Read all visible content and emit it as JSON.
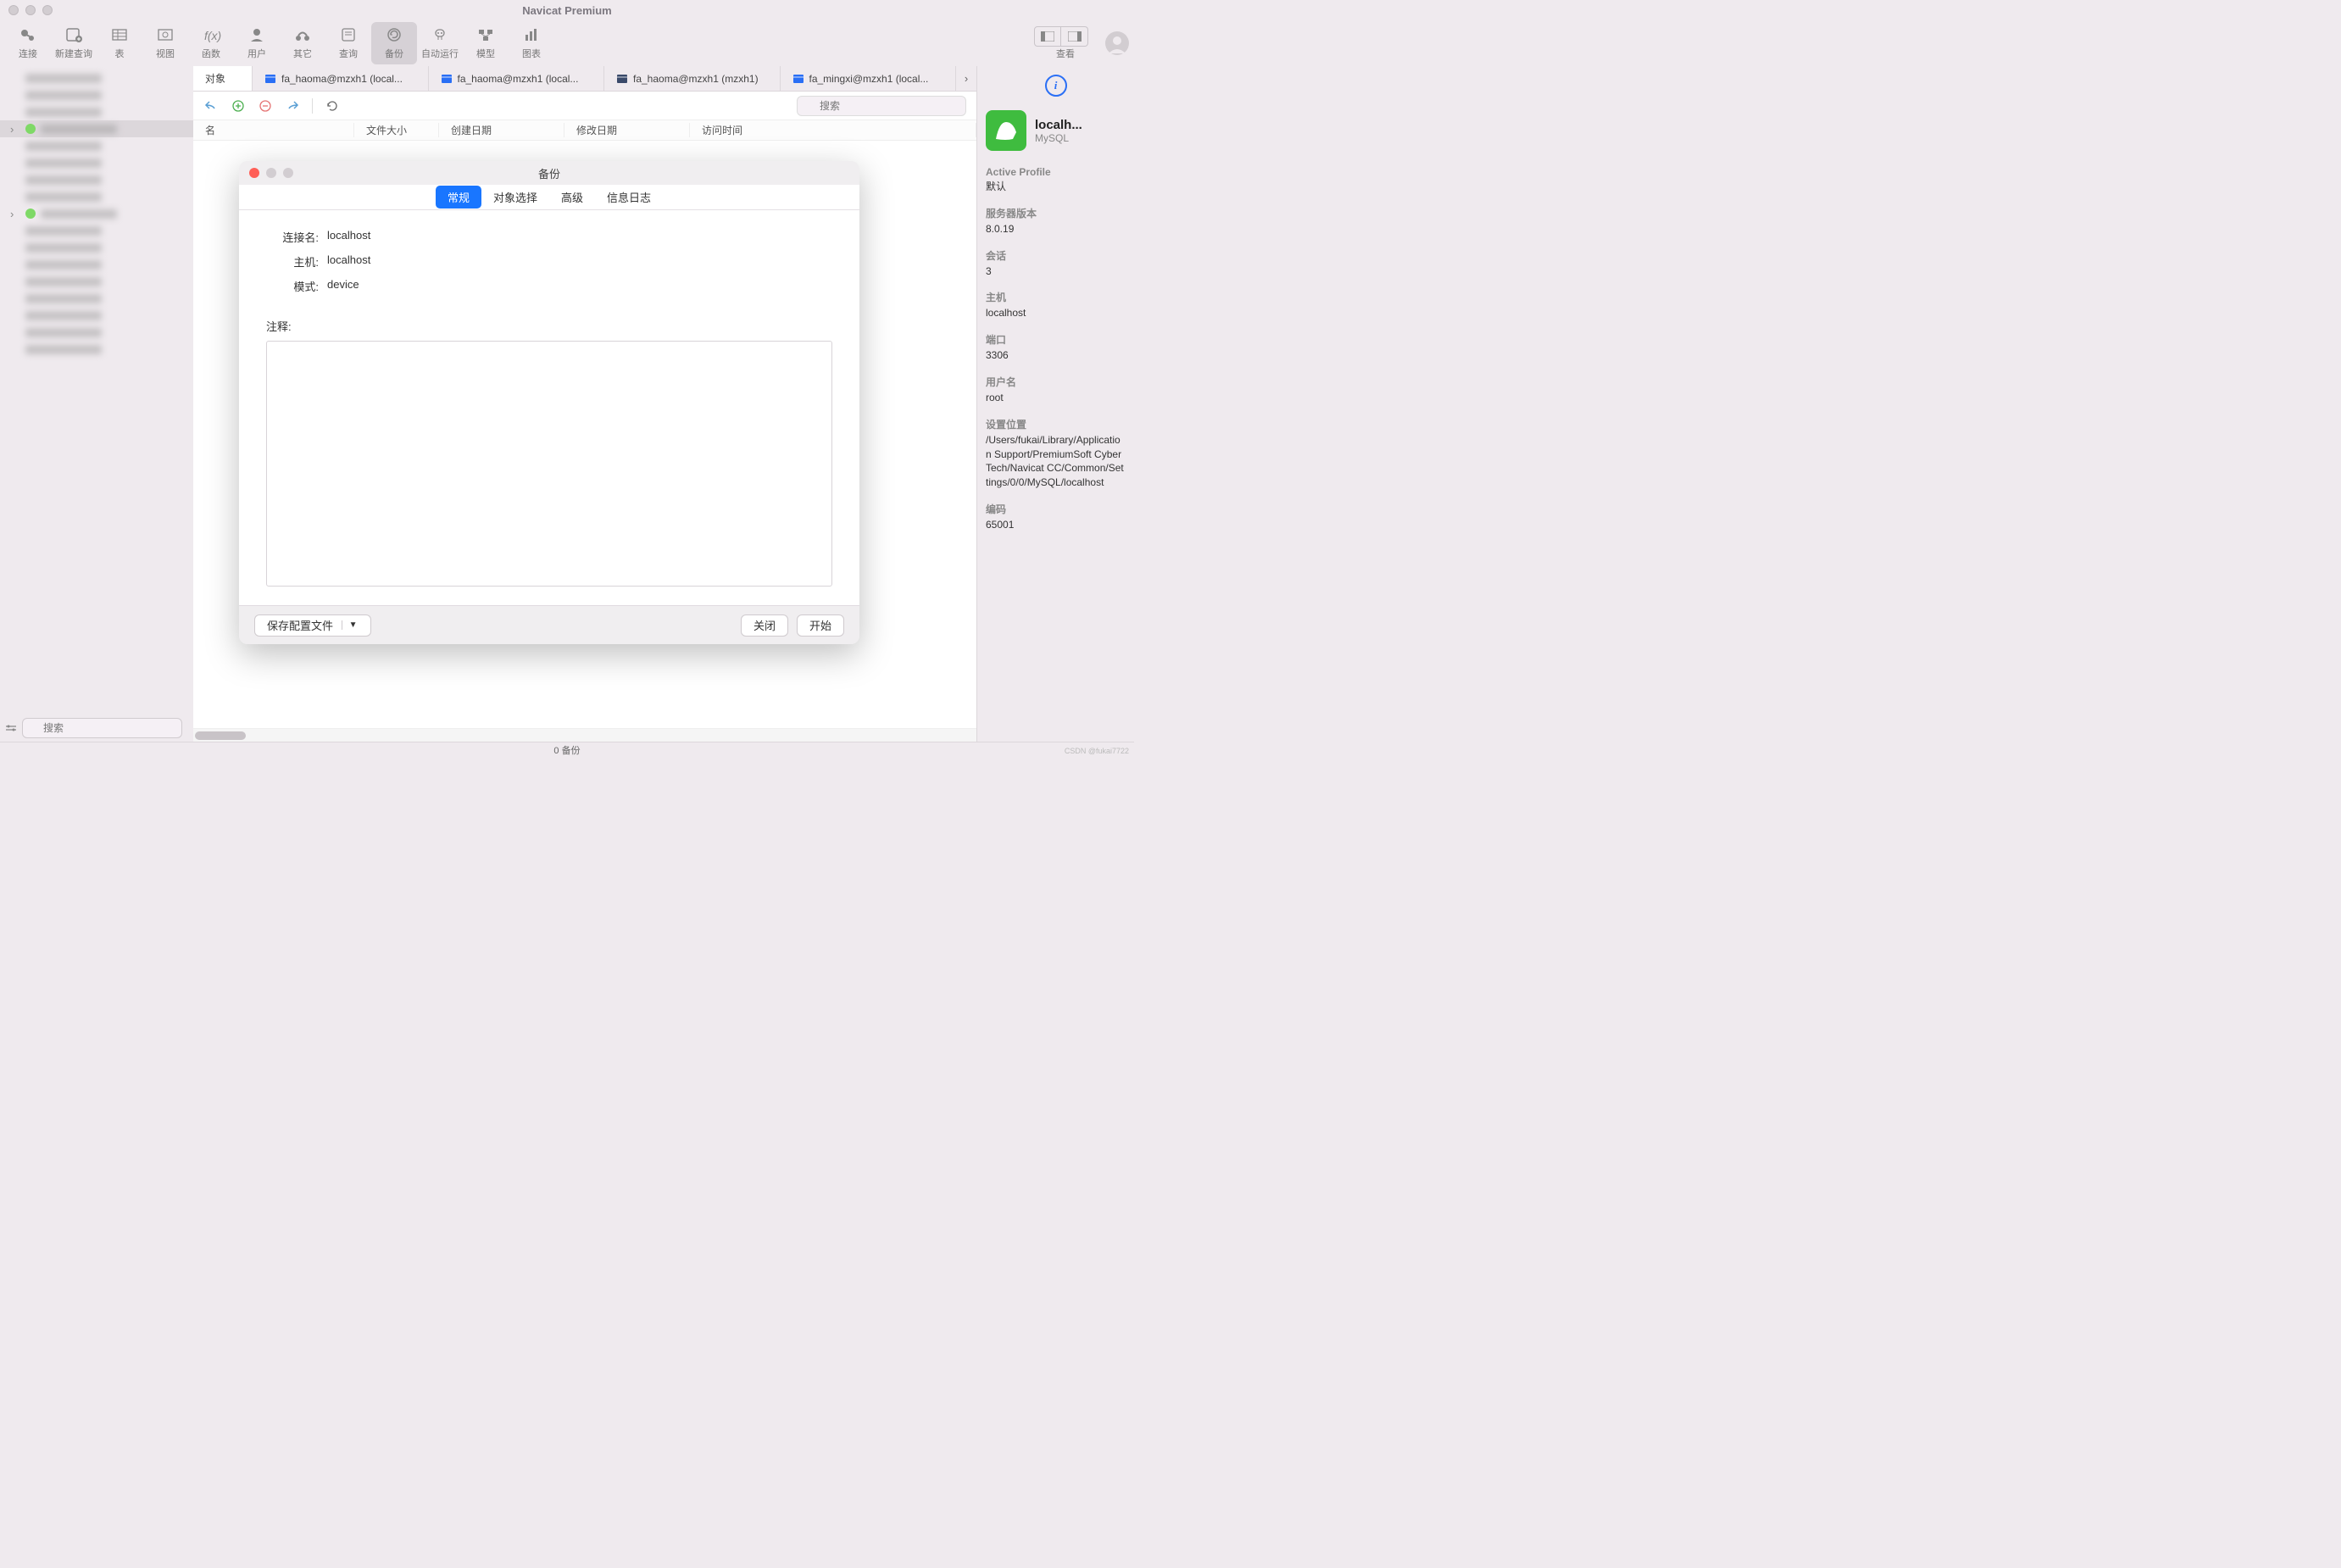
{
  "window": {
    "title": "Navicat Premium"
  },
  "toolbar": {
    "items": [
      {
        "label": "连接"
      },
      {
        "label": "新建查询"
      },
      {
        "label": "表"
      },
      {
        "label": "视图"
      },
      {
        "label": "函数"
      },
      {
        "label": "用户"
      },
      {
        "label": "其它"
      },
      {
        "label": "查询"
      },
      {
        "label": "备份"
      },
      {
        "label": "自动运行"
      },
      {
        "label": "模型"
      },
      {
        "label": "图表"
      }
    ],
    "active_index": 8,
    "view_label": "查看"
  },
  "tabs": {
    "items": [
      {
        "label": "对象",
        "active": true
      },
      {
        "label": "fa_haoma@mzxh1 (local..."
      },
      {
        "label": "fa_haoma@mzxh1 (local..."
      },
      {
        "label": "fa_haoma@mzxh1 (mzxh1)"
      },
      {
        "label": "fa_mingxi@mzxh1 (local..."
      }
    ]
  },
  "action_bar": {
    "search_placeholder": "搜索"
  },
  "columns": [
    "名",
    "文件大小",
    "创建日期",
    "修改日期",
    "访问时间"
  ],
  "sidebar": {
    "search_placeholder": "搜索"
  },
  "info": {
    "title": "localh...",
    "subtitle": "MySQL",
    "sections": [
      {
        "label": "Active Profile",
        "value": "默认"
      },
      {
        "label": "服务器版本",
        "value": "8.0.19"
      },
      {
        "label": "会话",
        "value": "3"
      },
      {
        "label": "主机",
        "value": "localhost"
      },
      {
        "label": "端口",
        "value": "3306"
      },
      {
        "label": "用户名",
        "value": "root"
      },
      {
        "label": "设置位置",
        "value": "/Users/fukai/Library/Application Support/PremiumSoft CyberTech/Navicat CC/Common/Settings/0/0/MySQL/localhost"
      },
      {
        "label": "编码",
        "value": "65001"
      }
    ]
  },
  "statusbar": {
    "text": "0 备份"
  },
  "dialog": {
    "title": "备份",
    "tabs": [
      "常规",
      "对象选择",
      "高级",
      "信息日志"
    ],
    "active_tab": 0,
    "fields": [
      {
        "label": "连接名:",
        "value": "localhost"
      },
      {
        "label": "主机:",
        "value": "localhost"
      },
      {
        "label": "模式:",
        "value": "device"
      }
    ],
    "notes_label": "注释:",
    "save_profile": "保存配置文件",
    "close": "关闭",
    "start": "开始"
  },
  "watermark": "CSDN @fukai7722"
}
